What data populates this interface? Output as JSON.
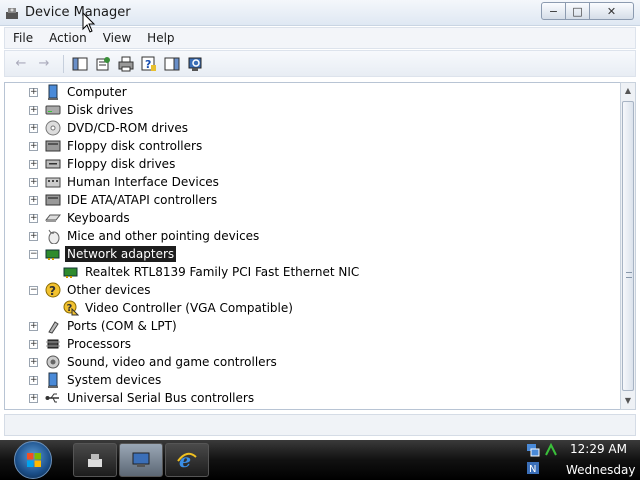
{
  "window": {
    "title": "Device Manager",
    "buttons": {
      "minimize": "−",
      "maximize": "□",
      "close": "✕"
    }
  },
  "menu": [
    "File",
    "Action",
    "View",
    "Help"
  ],
  "toolbar": {
    "icons": [
      "back-arrow-icon",
      "forward-arrow-icon",
      "show-hide-console-tree-icon",
      "properties-icon",
      "print-icon",
      "help-icon",
      "show-hide-action-pane-icon",
      "scan-hardware-icon"
    ]
  },
  "tree": {
    "items": [
      {
        "label": "Computer",
        "icon": "computer-icon",
        "expanded": false,
        "level": 0
      },
      {
        "label": "Disk drives",
        "icon": "disk-drive-icon",
        "expanded": false,
        "level": 0
      },
      {
        "label": "DVD/CD-ROM drives",
        "icon": "dvd-drive-icon",
        "expanded": false,
        "level": 0
      },
      {
        "label": "Floppy disk controllers",
        "icon": "floppy-controller-icon",
        "expanded": false,
        "level": 0
      },
      {
        "label": "Floppy disk drives",
        "icon": "floppy-drive-icon",
        "expanded": false,
        "level": 0
      },
      {
        "label": "Human Interface Devices",
        "icon": "hid-icon",
        "expanded": false,
        "level": 0
      },
      {
        "label": "IDE ATA/ATAPI controllers",
        "icon": "ide-controller-icon",
        "expanded": false,
        "level": 0
      },
      {
        "label": "Keyboards",
        "icon": "keyboard-icon",
        "expanded": false,
        "level": 0
      },
      {
        "label": "Mice and other pointing devices",
        "icon": "mouse-icon",
        "expanded": false,
        "level": 0
      },
      {
        "label": "Network adapters",
        "icon": "network-adapter-icon",
        "expanded": true,
        "level": 0,
        "selected": true
      },
      {
        "label": "Realtek RTL8139 Family PCI Fast Ethernet NIC",
        "icon": "network-card-icon",
        "level": 1
      },
      {
        "label": "Other devices",
        "icon": "unknown-device-icon",
        "expanded": true,
        "level": 0
      },
      {
        "label": "Video Controller (VGA Compatible)",
        "icon": "warning-device-icon",
        "level": 1
      },
      {
        "label": "Ports (COM & LPT)",
        "icon": "port-icon",
        "expanded": false,
        "level": 0
      },
      {
        "label": "Processors",
        "icon": "processor-icon",
        "expanded": false,
        "level": 0
      },
      {
        "label": "Sound, video and game controllers",
        "icon": "sound-icon",
        "expanded": false,
        "level": 0
      },
      {
        "label": "System devices",
        "icon": "system-devices-icon",
        "expanded": false,
        "level": 0
      },
      {
        "label": "Universal Serial Bus controllers",
        "icon": "usb-icon",
        "expanded": false,
        "level": 0
      }
    ]
  },
  "taskbar": {
    "clock_time": "12:29 AM",
    "clock_day": "Wednesday"
  }
}
